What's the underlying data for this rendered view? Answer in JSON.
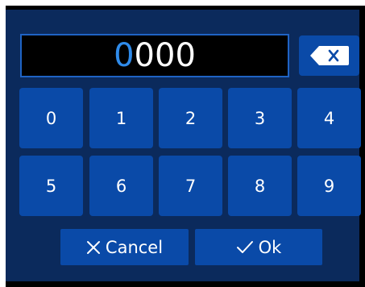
{
  "display": {
    "cursor_digit": "0",
    "rest_digits": "000"
  },
  "keys": [
    "0",
    "1",
    "2",
    "3",
    "4",
    "5",
    "6",
    "7",
    "8",
    "9"
  ],
  "buttons": {
    "cancel_label": "Cancel",
    "ok_label": "Ok"
  },
  "icons": {
    "backspace": "backspace-icon",
    "cancel": "close-icon",
    "ok": "check-icon"
  },
  "colors": {
    "panel": "#0b2a5c",
    "key": "#0a4aa8",
    "display_border": "#1f63c4",
    "cursor": "#2f8bea"
  }
}
